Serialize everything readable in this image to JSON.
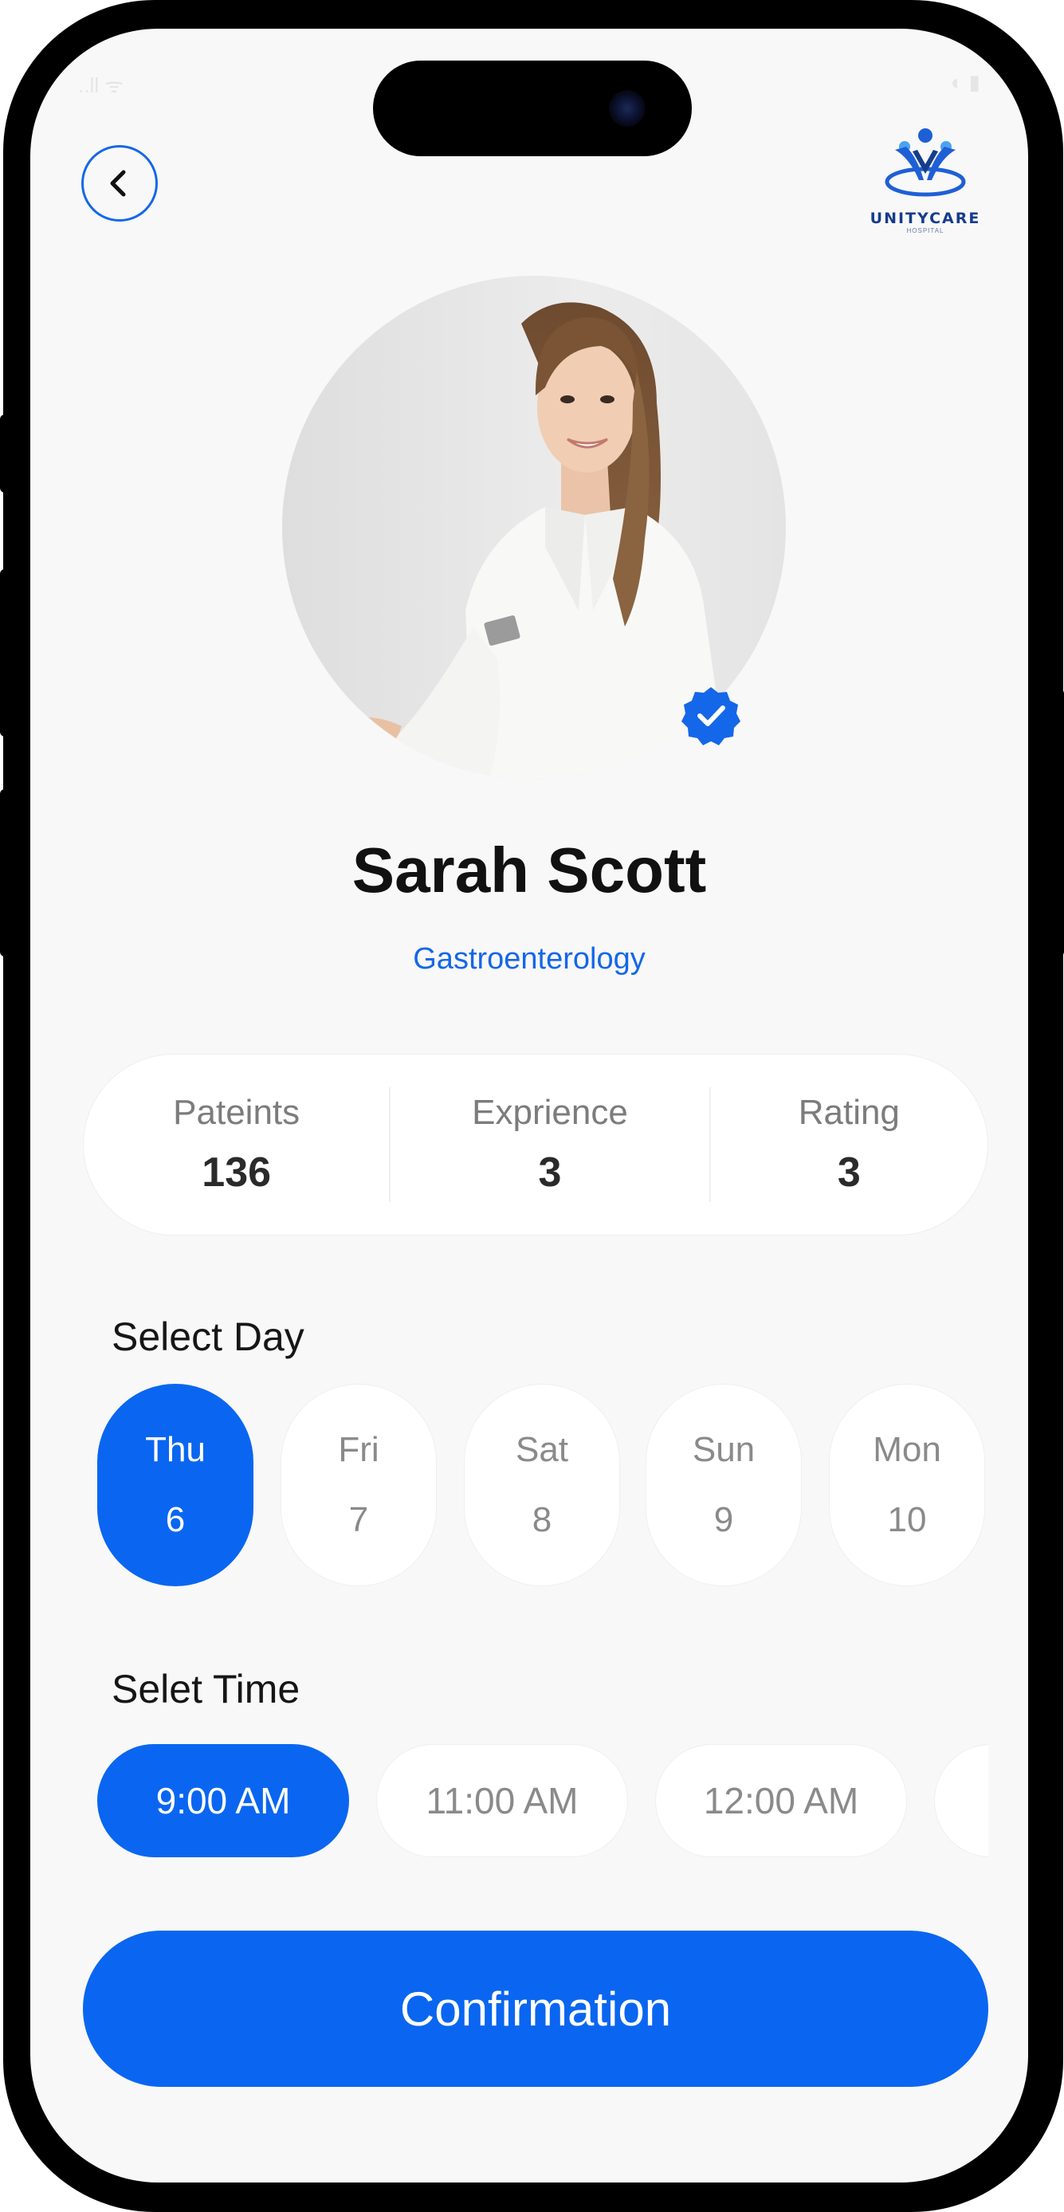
{
  "status_bar": {
    "left": "..ll  ᯤ",
    "right": "◐  ▮"
  },
  "logo": {
    "name": "UNITYCARE",
    "sub": "HOSPITAL"
  },
  "doctor": {
    "name": "Sarah Scott",
    "specialty": "Gastroenterology"
  },
  "stats": [
    {
      "label": "Pateints",
      "value": "136"
    },
    {
      "label": "Exprience",
      "value": "3"
    },
    {
      "label": "Rating",
      "value": "3"
    }
  ],
  "select_day": {
    "title": "Select Day",
    "days": [
      {
        "name": "Thu",
        "num": "6",
        "selected": true
      },
      {
        "name": "Fri",
        "num": "7",
        "selected": false
      },
      {
        "name": "Sat",
        "num": "8",
        "selected": false
      },
      {
        "name": "Sun",
        "num": "9",
        "selected": false
      },
      {
        "name": "Mon",
        "num": "10",
        "selected": false
      }
    ]
  },
  "select_time": {
    "title": "Selet Time",
    "times": [
      {
        "label": "9:00 AM",
        "selected": true
      },
      {
        "label": "11:00 AM",
        "selected": false
      },
      {
        "label": "12:00 AM",
        "selected": false
      },
      {
        "label": "",
        "selected": false
      }
    ]
  },
  "confirm_button": "Confirmation",
  "colors": {
    "accent": "#0a66f0",
    "background": "#f8f8f8",
    "frame": "#000000"
  },
  "icons": [
    "chevron-left-icon",
    "verified-badge-icon",
    "unitycare-logo-icon"
  ]
}
